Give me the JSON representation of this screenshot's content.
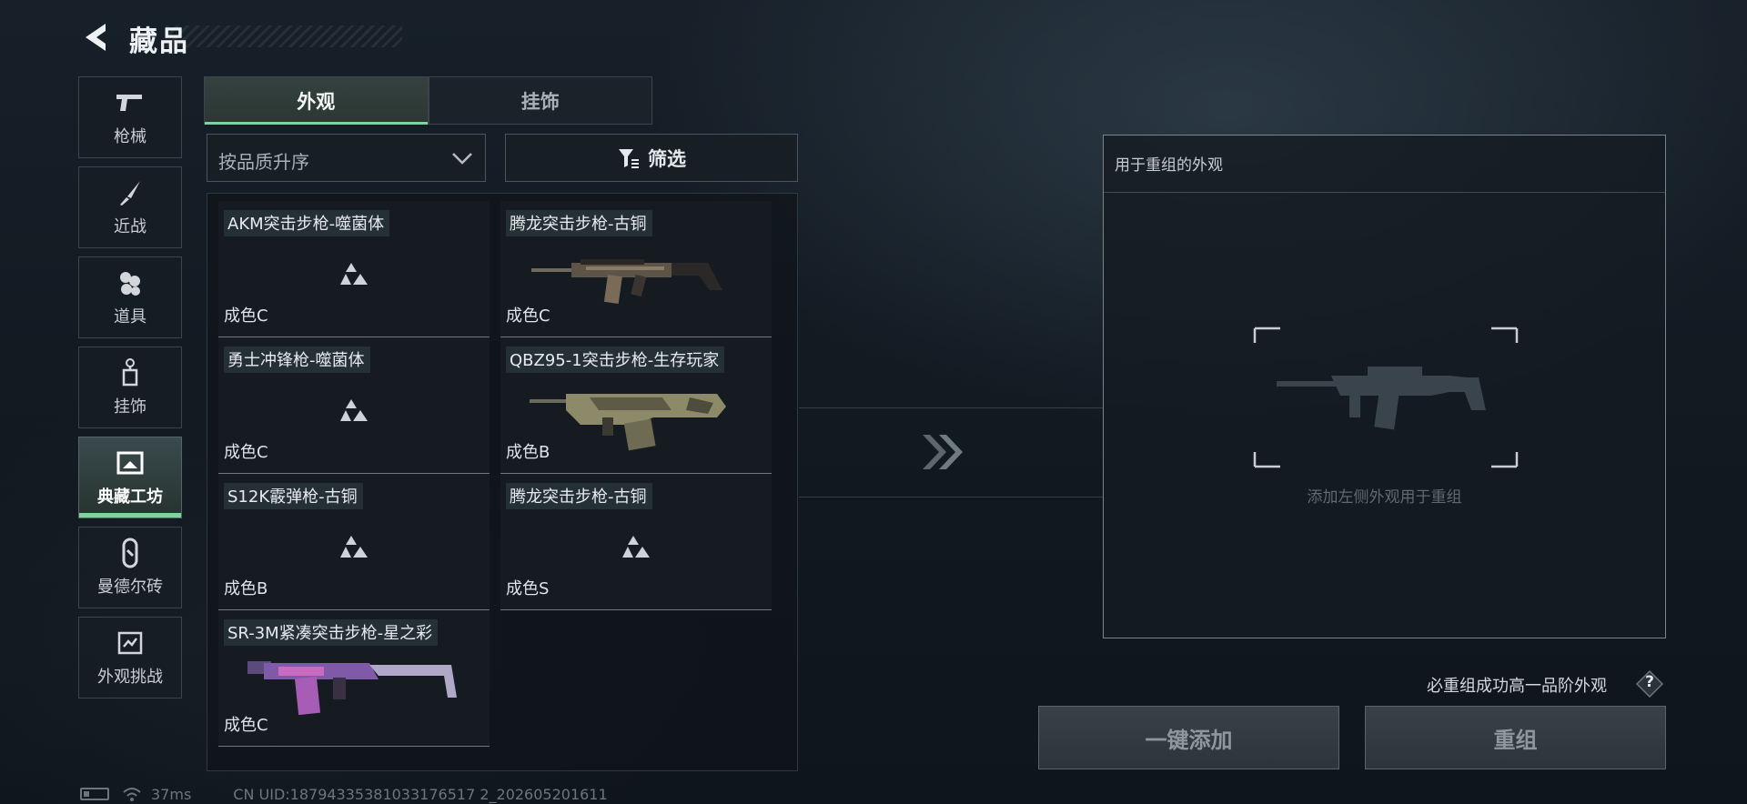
{
  "header": {
    "title": "藏品"
  },
  "nav": {
    "items": [
      {
        "label": "枪械",
        "icon": "pistol-icon"
      },
      {
        "label": "近战",
        "icon": "knife-icon"
      },
      {
        "label": "道具",
        "icon": "grenade-icon"
      },
      {
        "label": "挂饰",
        "icon": "charm-icon"
      },
      {
        "label": "典藏工坊",
        "icon": "workshop-icon",
        "active": true
      },
      {
        "label": "曼德尔砖",
        "icon": "mandel-brick-icon"
      },
      {
        "label": "外观挑战",
        "icon": "challenge-icon"
      }
    ]
  },
  "tabs": [
    {
      "label": "外观",
      "active": true
    },
    {
      "label": "挂饰",
      "active": false
    }
  ],
  "sort": {
    "label": "按品质升序"
  },
  "filter": {
    "label": "筛选"
  },
  "items": [
    {
      "name": "AKM突击步枪-噬菌体",
      "grade": "成色C",
      "image": "placeholder"
    },
    {
      "name": "腾龙突击步枪-古铜",
      "grade": "成色C",
      "image": "gun-bronze"
    },
    {
      "name": "勇士冲锋枪-噬菌体",
      "grade": "成色C",
      "image": "placeholder"
    },
    {
      "name": "QBZ95-1突击步枪-生存玩家",
      "grade": "成色B",
      "image": "gun-camo"
    },
    {
      "name": "S12K霰弹枪-古铜",
      "grade": "成色B",
      "image": "placeholder"
    },
    {
      "name": "腾龙突击步枪-古铜",
      "grade": "成色S",
      "image": "placeholder"
    },
    {
      "name": "SR-3M紧凑突击步枪-星之彩",
      "grade": "成色C",
      "image": "gun-purple"
    }
  ],
  "recombine": {
    "title": "用于重组的外观",
    "hint": "添加左侧外观用于重组",
    "tip": "必重组成功高一品阶外观",
    "help": "?",
    "add_all": "一键添加",
    "recombine": "重组"
  },
  "status": {
    "ping": "37ms",
    "uid": "CN UID:18794335381033176517 2_202605201611"
  },
  "colors": {
    "accent": "#7fd39b",
    "panel_border": "#3a4550"
  }
}
